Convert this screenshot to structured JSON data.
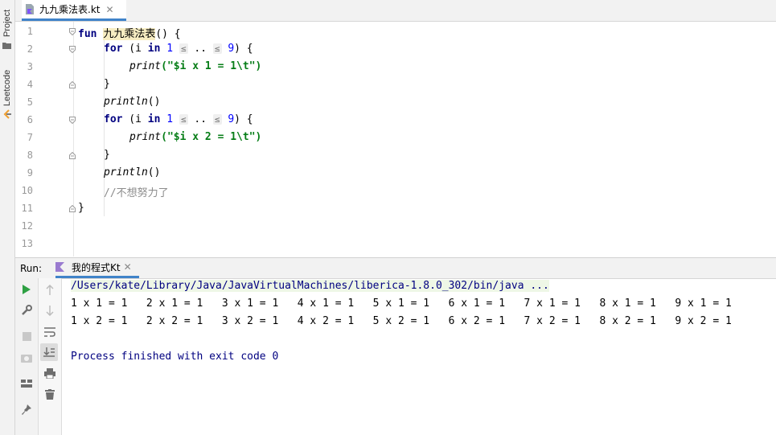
{
  "sidebar": {
    "items": [
      {
        "label": "Project",
        "icon": "folder-icon"
      },
      {
        "label": "Leetcode",
        "icon": "leetcode-icon"
      }
    ]
  },
  "editor_tabs": [
    {
      "label": "九九乘法表.kt",
      "active": true,
      "icon": "kotlin-file-icon"
    }
  ],
  "editor": {
    "line_numbers": [
      "1",
      "2",
      "3",
      "4",
      "5",
      "6",
      "7",
      "8",
      "9",
      "10",
      "11",
      "12",
      "13"
    ],
    "tokens": {
      "fun": "fun",
      "func_name": "九九乘法表",
      "paren_open": "() {",
      "for": "for",
      "open_i": " (i ",
      "in": "in",
      "one": "1",
      "le": "≤",
      "range": " .. ",
      "nine": "9",
      "close_brace_open": ") {",
      "print": "print",
      "str1": "(\"$i x 1 = 1\\t\")",
      "str2": "(\"$i x 2 = 1\\t\")",
      "close_brace": "}",
      "println": "println",
      "empty_parens": "()",
      "comment": "//不想努力了"
    }
  },
  "run_panel": {
    "label": "Run:",
    "tab_label": "我的程式Kt",
    "command": "/Users/kate/Library/Java/JavaVirtualMachines/liberica-1.8.0_302/bin/java ...",
    "output_lines": [
      "1 x 1 = 1   2 x 1 = 1   3 x 1 = 1   4 x 1 = 1   5 x 1 = 1   6 x 1 = 1   7 x 1 = 1   8 x 1 = 1   9 x 1 = 1",
      "1 x 2 = 1   2 x 2 = 1   3 x 2 = 1   4 x 2 = 1   5 x 2 = 1   6 x 2 = 1   7 x 2 = 1   8 x 2 = 1   9 x 2 = 1"
    ],
    "exit_message": "Process finished with exit code 0"
  },
  "colors": {
    "accent": "#4083c9",
    "keyword": "#000080",
    "string": "#067d17",
    "number": "#0000ff",
    "run_green": "#2ea043"
  }
}
